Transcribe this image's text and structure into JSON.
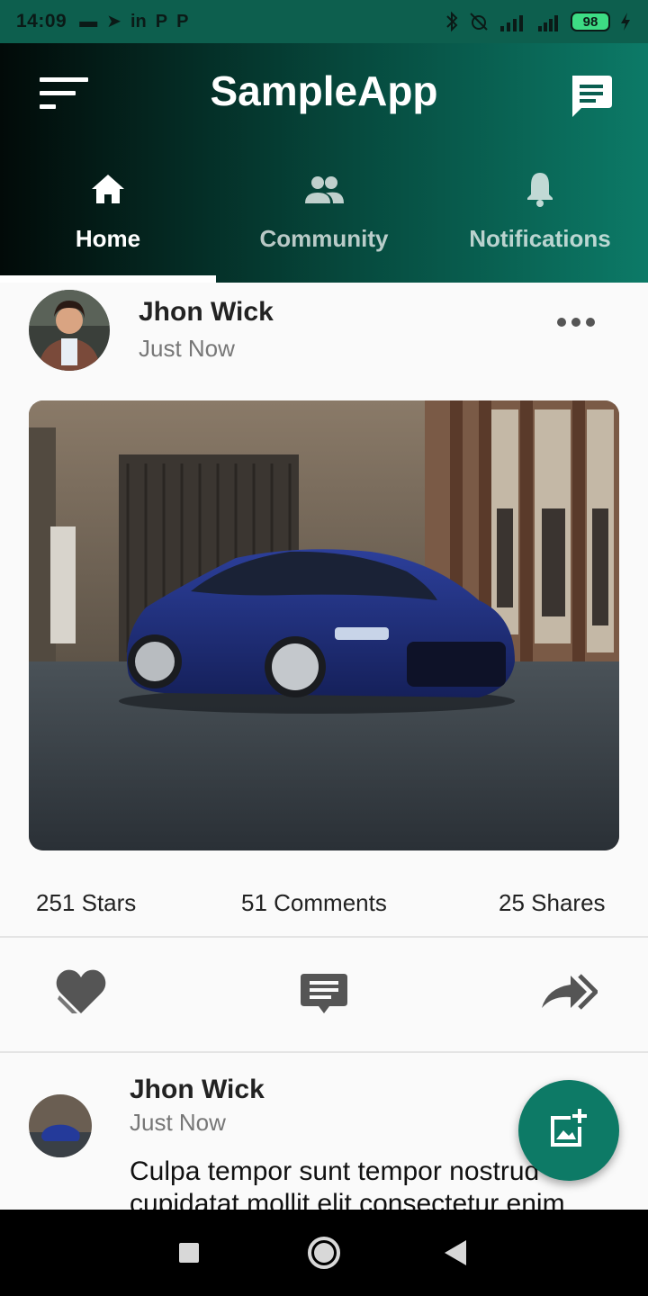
{
  "status_bar": {
    "time": "14:09",
    "battery_level": "98",
    "left_icons": [
      "message-icon",
      "telegram-icon",
      "linkedin-icon",
      "p-icon",
      "p-icon"
    ],
    "left_glyphs": [
      "▬",
      "➤",
      "in",
      "P",
      "P"
    ],
    "right_icons": [
      "bluetooth-icon",
      "alarm-off-icon",
      "signal-4g-icon",
      "signal-icon",
      "battery-icon",
      "charging-icon"
    ]
  },
  "header": {
    "title": "SampleApp",
    "menu_icon": "sort-menu-icon",
    "chat_icon": "chat-icon"
  },
  "tabs": [
    {
      "label": "Home",
      "icon": "home-icon",
      "active": true
    },
    {
      "label": "Community",
      "icon": "people-icon",
      "active": false
    },
    {
      "label": "Notifications",
      "icon": "bell-icon",
      "active": false
    }
  ],
  "post": {
    "author": "Jhon Wick",
    "time": "Just Now",
    "more_icon": "more-horizontal-icon",
    "image_subject": "blue sedan parked in alley",
    "stats": {
      "stars": "251 Stars",
      "comments": "51 Comments",
      "shares": "25 Shares"
    },
    "actions": [
      "heart-icon",
      "comment-icon",
      "share-icon"
    ]
  },
  "post2": {
    "author": "Jhon Wick",
    "time": "Just Now",
    "body": "Culpa tempor sunt tempor nostrud cupidatat mollit elit consectetur enim"
  },
  "fab": {
    "icon": "add-photo-icon"
  },
  "nav_bar": [
    "recents-icon",
    "home-circle-icon",
    "back-icon"
  ],
  "colors": {
    "primary": "#0d7a66",
    "header_dark": "#020a08",
    "status_bar": "#0d5f4e",
    "battery": "#3ddc84"
  }
}
